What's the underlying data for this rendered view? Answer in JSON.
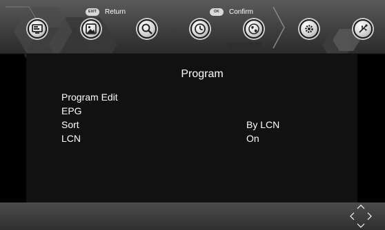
{
  "header": {
    "menu_icons": [
      {
        "name": "tv-icon"
      },
      {
        "name": "picture-icon"
      },
      {
        "name": "search-icon"
      },
      {
        "name": "clock-icon"
      },
      {
        "name": "globe-icon"
      },
      {
        "name": "gear-icon"
      },
      {
        "name": "usb-icon"
      }
    ],
    "active_icon": "globe-icon"
  },
  "page_title": "Program",
  "menu": {
    "items": [
      {
        "label": "Program Edit",
        "value": ""
      },
      {
        "label": "EPG",
        "value": ""
      },
      {
        "label": "Sort",
        "value": "By LCN"
      },
      {
        "label": "LCN",
        "value": "On"
      }
    ]
  },
  "footer": {
    "return_key": "EXIT",
    "return_label": "Return",
    "confirm_key": "OK",
    "confirm_label": "Confirm"
  },
  "colors": {
    "background": "#000000",
    "panel": "#111111",
    "bar": "#4a4a4a",
    "text": "#ffffff"
  }
}
